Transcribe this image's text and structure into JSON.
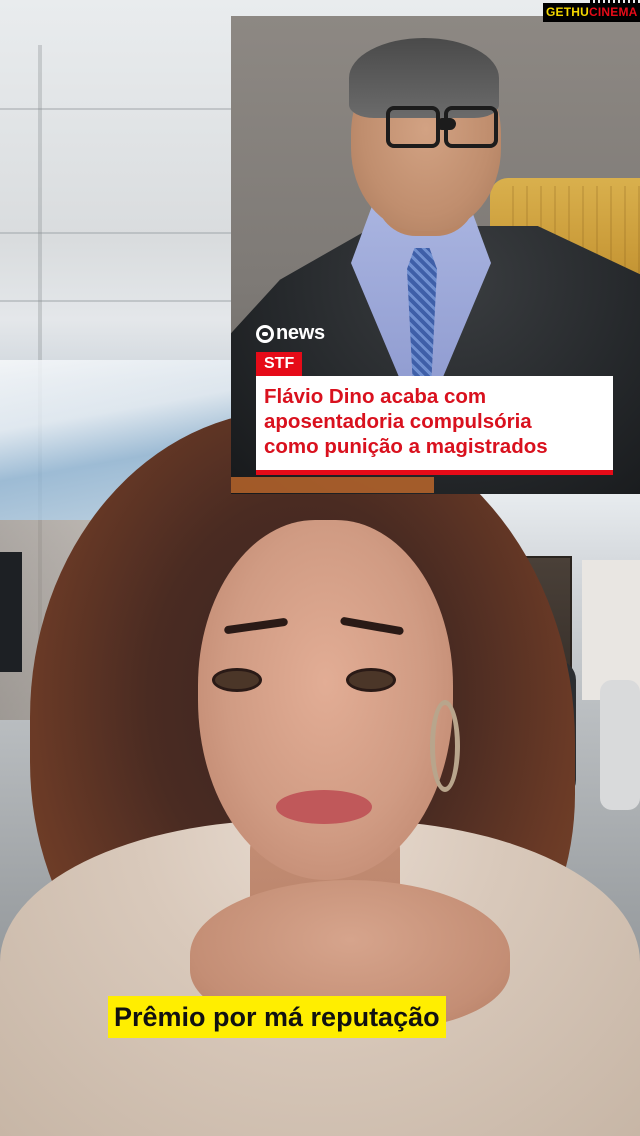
{
  "watermark": {
    "text_left": "GETHU",
    "text_right": "CINEMA"
  },
  "news": {
    "logo_text": "news",
    "badge": "STF",
    "headline_lines": [
      "Flávio Dino acaba com",
      "aposentadoria compulsória",
      "como punição a magistrados"
    ]
  },
  "caption": {
    "text": "Prêmio por má reputação"
  },
  "colors": {
    "news_red": "#e60b18",
    "caption_yellow": "#ffee00",
    "watermark_yellow": "#f3d700"
  }
}
